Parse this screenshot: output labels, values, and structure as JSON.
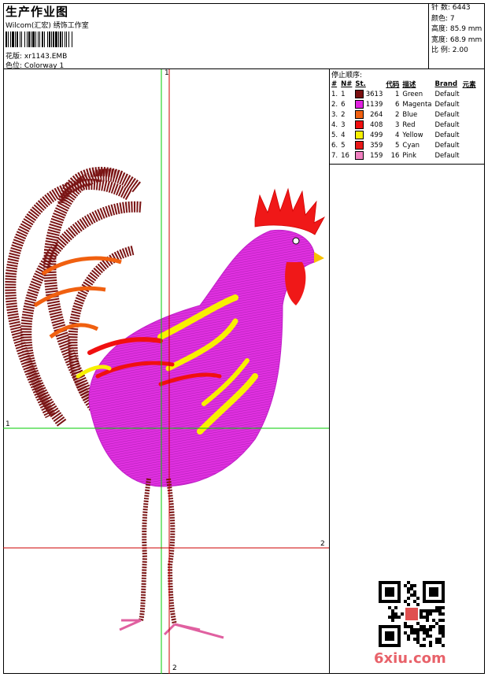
{
  "header": {
    "title": "生产作业图",
    "studio": "Wilcom(汇宏) 绣饰工作室",
    "design_label": "花版:",
    "design_file": "xr1143.EMB",
    "colorway_label": "色位:",
    "colorway": "Colorway 1"
  },
  "stats": {
    "stitches": "针 数: 6443",
    "colors": "颜色: 7",
    "height": "高度: 85.9 mm",
    "width": "宽度: 68.9 mm",
    "scale": "比 例: 2.00"
  },
  "stops": {
    "heading": "停止顺序:",
    "columns": [
      "#",
      "N#",
      "St.",
      "代码",
      "描述",
      "Brand",
      "元素"
    ],
    "rows": [
      {
        "n": "1.",
        "needle": "1",
        "color": "#7a1010",
        "st": "3613",
        "code": "1",
        "desc": "Green",
        "brand": "Default"
      },
      {
        "n": "2.",
        "needle": "6",
        "color": "#e020e0",
        "st": "1139",
        "code": "6",
        "desc": "Magenta",
        "brand": "Default"
      },
      {
        "n": "3.",
        "needle": "2",
        "color": "#f06010",
        "st": "264",
        "code": "2",
        "desc": "Blue",
        "brand": "Default"
      },
      {
        "n": "4.",
        "needle": "3",
        "color": "#f01010",
        "st": "408",
        "code": "3",
        "desc": "Red",
        "brand": "Default"
      },
      {
        "n": "5.",
        "needle": "4",
        "color": "#f8f000",
        "st": "499",
        "code": "4",
        "desc": "Yellow",
        "brand": "Default"
      },
      {
        "n": "6.",
        "needle": "5",
        "color": "#e81818",
        "st": "359",
        "code": "5",
        "desc": "Cyan",
        "brand": "Default"
      },
      {
        "n": "7.",
        "needle": "16",
        "color": "#f080c0",
        "st": "159",
        "code": "16",
        "desc": "Pink",
        "brand": "Default"
      }
    ]
  },
  "guides": {
    "green_top": "1",
    "green_left": "1",
    "red_right": "2",
    "red_bottom": "2"
  },
  "watermark": "6xiu.com",
  "colors": {
    "green_guide": "#00cc00",
    "red_guide": "#cc0000",
    "maroon": "#7a1010",
    "magenta": "#e020e0",
    "orange": "#f06010",
    "red": "#f01010",
    "yellow": "#f8f000",
    "pink": "#f080c0"
  }
}
